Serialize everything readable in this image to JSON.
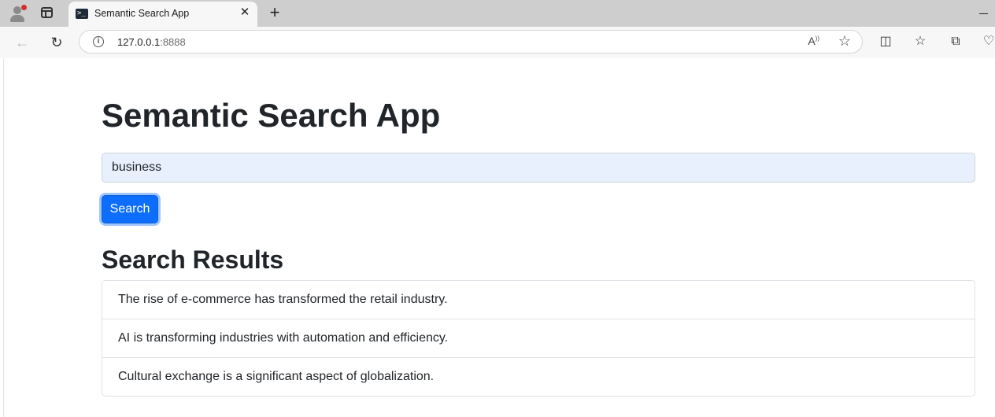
{
  "browser": {
    "tab_title": "Semantic Search App",
    "favicon_glyph": ">_",
    "url_host": "127.0.0.1",
    "url_port": ":8888"
  },
  "page": {
    "title": "Semantic Search App",
    "search": {
      "value": "business"
    },
    "search_button_label": "Search",
    "results_heading": "Search Results",
    "results": [
      "The rise of e-commerce has transformed the retail industry.",
      "AI is transforming industries with automation and efficiency.",
      "Cultural exchange is a significant aspect of globalization."
    ]
  },
  "colors": {
    "primary_button": "#0d6efd",
    "input_autofill_bg": "#e8f0fe"
  }
}
